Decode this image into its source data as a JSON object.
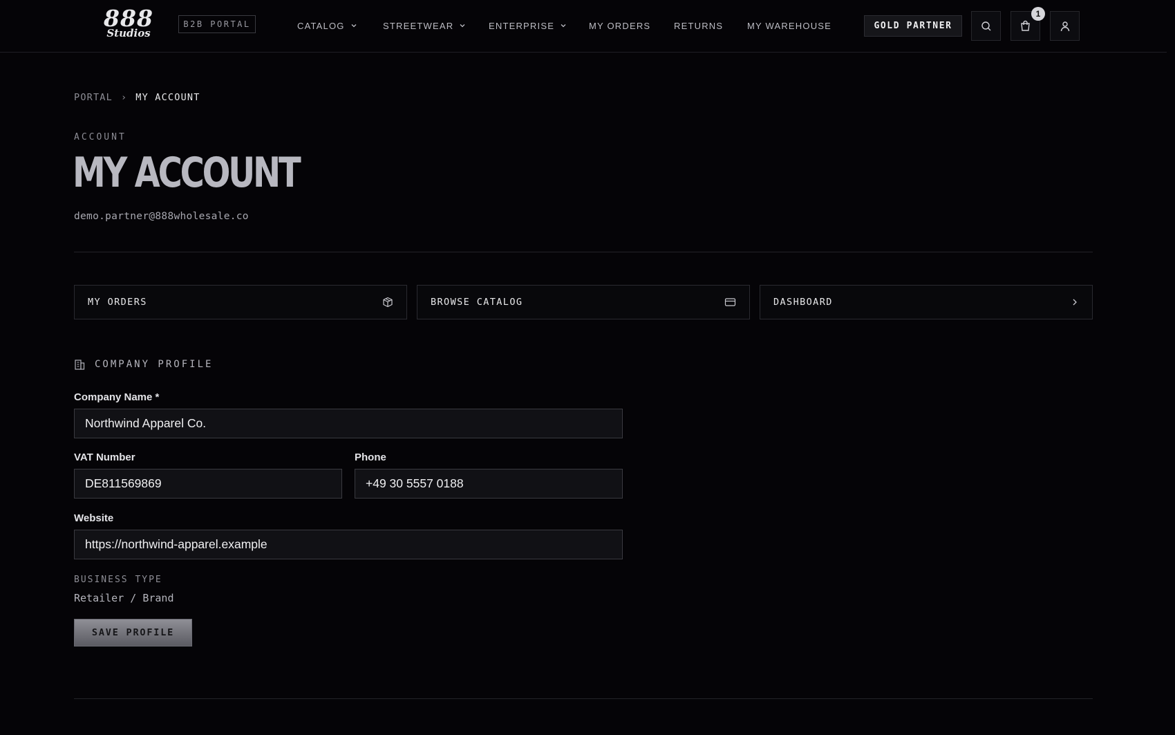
{
  "header": {
    "logo": {
      "line1": "888",
      "line2": "Studios"
    },
    "badge": "B2B PORTAL",
    "nav": [
      {
        "label": "CATALOG",
        "dropdown": true
      },
      {
        "label": "STREETWEAR",
        "dropdown": true
      },
      {
        "label": "ENTERPRISE",
        "dropdown": true
      },
      {
        "label": "MY ORDERS",
        "dropdown": false
      },
      {
        "label": "RETURNS",
        "dropdown": false
      },
      {
        "label": "MY WAREHOUSE",
        "dropdown": false
      }
    ],
    "tier": "GOLD PARTNER",
    "icons": [
      "search-icon",
      "shopping-bag-icon",
      "user-icon"
    ],
    "cart_count": "1"
  },
  "breadcrumb": {
    "root": "PORTAL",
    "separator": "›",
    "current": "MY ACCOUNT"
  },
  "page": {
    "eyebrow": "ACCOUNT",
    "title": "MY ACCOUNT",
    "email": "demo.partner@888wholesale.co"
  },
  "quick_links": [
    {
      "label": "MY ORDERS",
      "icon": "box-icon"
    },
    {
      "label": "BROWSE CATALOG",
      "icon": "card-icon"
    },
    {
      "label": "DASHBOARD",
      "icon": "chevron-right-icon"
    }
  ],
  "profile": {
    "section_title": "COMPANY PROFILE",
    "section_icon": "building-icon",
    "company_name": {
      "label": "Company Name *",
      "value": "Northwind Apparel Co."
    },
    "vat": {
      "label": "VAT Number",
      "value": "DE811569869"
    },
    "phone": {
      "label": "Phone",
      "value": "+49 30 5557 0188"
    },
    "website": {
      "label": "Website",
      "value": "https://northwind-apparel.example"
    },
    "business_type": {
      "label": "BUSINESS TYPE",
      "value": "Retailer / Brand"
    },
    "save_label": "SAVE PROFILE"
  },
  "colors": {
    "background": "#050407",
    "text": "#d8d8dc",
    "muted": "#8d8d95",
    "border": "#2a2a30"
  }
}
